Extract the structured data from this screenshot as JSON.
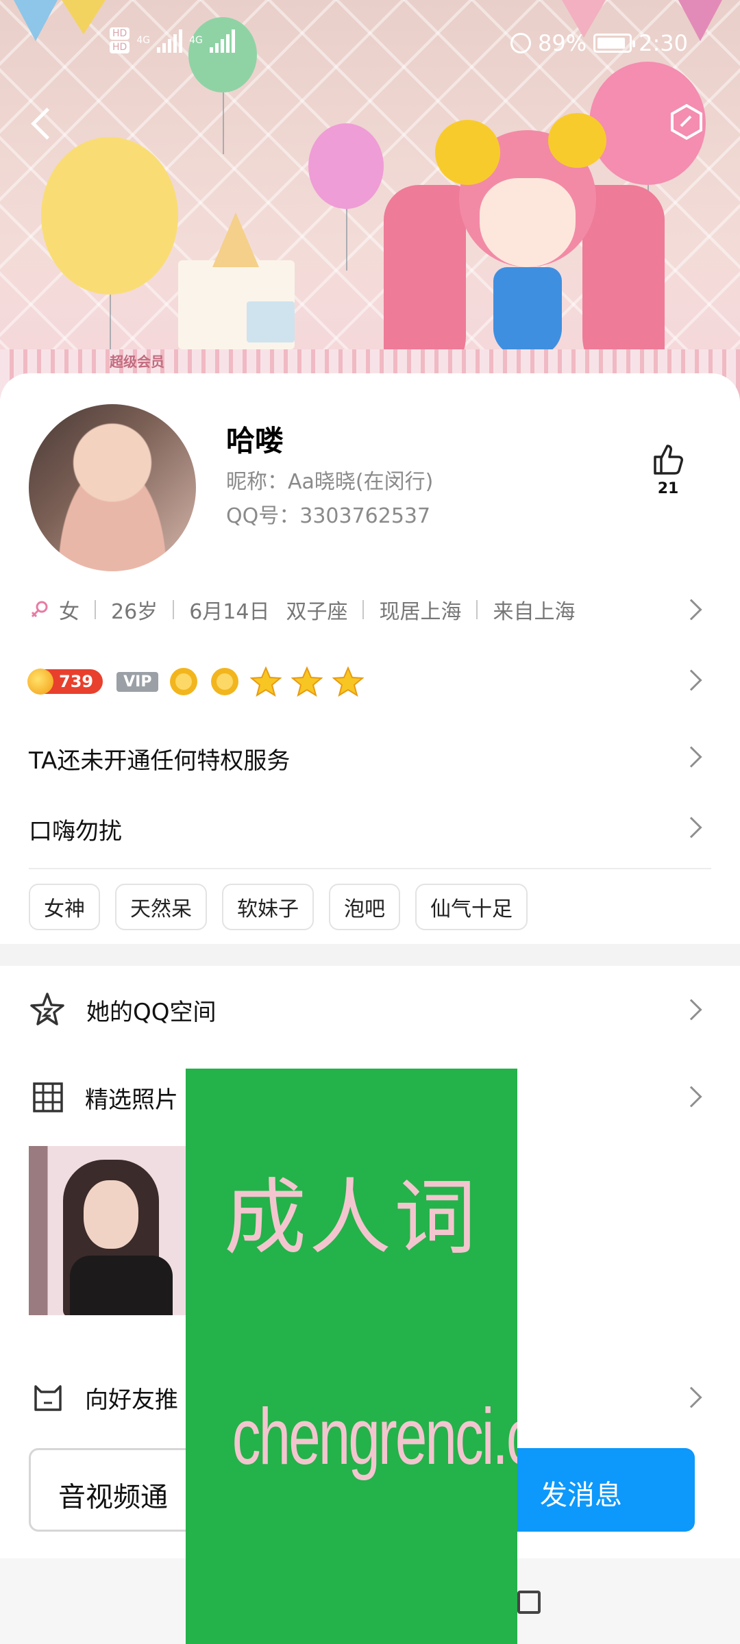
{
  "status_bar": {
    "network_left": "4G",
    "network_right": "4G",
    "battery": "89%",
    "time": "2:30"
  },
  "banner": {
    "badge": "超级会员"
  },
  "profile": {
    "name": "哈喽",
    "nickname": "昵称：Aa晓晓(在闵行)",
    "qq": "QQ号：3303762537",
    "likes": "21"
  },
  "info": {
    "gender": "女",
    "age": "26岁",
    "birthday": "6月14日",
    "zodiac": "双子座",
    "lives_in": "现居上海",
    "from": "来自上海"
  },
  "level": {
    "score": "739",
    "vip": "VIP",
    "icons": [
      "sun-badge",
      "sun-badge",
      "star-badge",
      "star-badge",
      "star-badge"
    ]
  },
  "privilege_text": "TA还未开通任何特权服务",
  "signature": "口嗨勿扰",
  "tags": [
    "女神",
    "天然呆",
    "软妹子",
    "泡吧",
    "仙气十足"
  ],
  "sections": {
    "qzone": "她的QQ空间",
    "photos": "精选照片",
    "recommend": "向好友推"
  },
  "actions": {
    "call": "音视频通",
    "message": "发消息"
  },
  "watermark": {
    "title": "成人词",
    "url": "chengrenci.com"
  },
  "colors": {
    "accent": "#0d98fb",
    "coin_badge": "#e8402d",
    "watermark_bg": "#24b24a"
  }
}
